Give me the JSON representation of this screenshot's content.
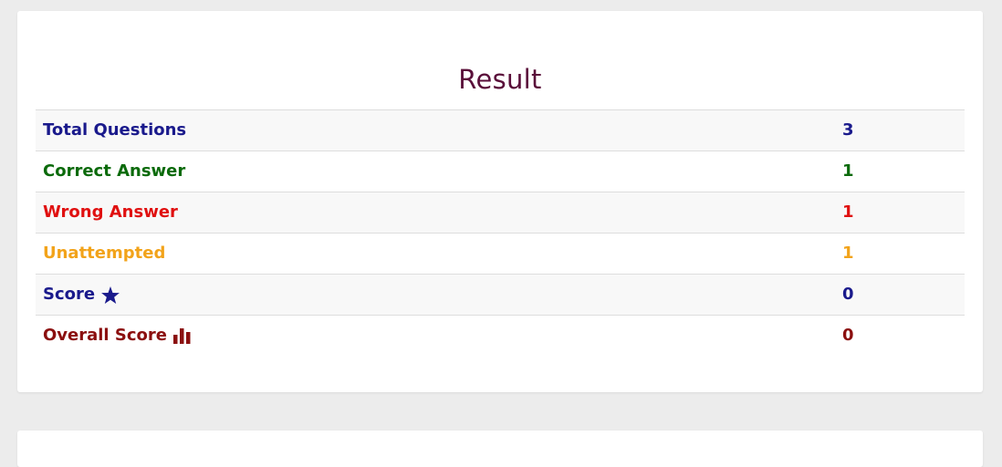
{
  "result": {
    "title": "Result",
    "rows": [
      {
        "label": "Total Questions",
        "value": "3",
        "color": "#1a1a8c"
      },
      {
        "label": "Correct Answer",
        "value": "1",
        "color": "#0b6a0b"
      },
      {
        "label": "Wrong Answer",
        "value": "1",
        "color": "#e01010"
      },
      {
        "label": "Unattempted",
        "value": "1",
        "color": "#f2a31a"
      },
      {
        "label": "Score",
        "value": "0",
        "color": "#1a1a8c",
        "icon": "star-icon"
      },
      {
        "label": "Overall Score",
        "value": "0",
        "color": "#8b0f0f",
        "icon": "bar-chart-icon"
      }
    ]
  }
}
